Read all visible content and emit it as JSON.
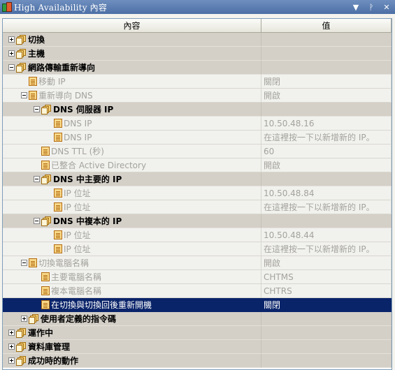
{
  "window": {
    "title": "High Availability 內容"
  },
  "columns": {
    "name": "內容",
    "value": "值"
  },
  "rows": [
    {
      "type": "cat",
      "level": 0,
      "expand": "plus",
      "icon": "folder-icon",
      "name": "切換",
      "value": ""
    },
    {
      "type": "cat",
      "level": 0,
      "expand": "plus",
      "icon": "folder-icon",
      "name": "主機",
      "value": ""
    },
    {
      "type": "cat",
      "level": 0,
      "expand": "minus",
      "icon": "folder-icon",
      "name": "網路傳輸重新導向",
      "value": ""
    },
    {
      "type": "prop",
      "level": 1,
      "expand": "none",
      "icon": "property-icon",
      "name": "移動 IP",
      "value": "關閉"
    },
    {
      "type": "prop",
      "level": 1,
      "expand": "minus",
      "icon": "property-icon",
      "name": "重新導向 DNS",
      "value": "開啟"
    },
    {
      "type": "cat",
      "level": 2,
      "expand": "minus",
      "icon": "folder-icon",
      "name": "DNS 伺服器 IP",
      "value": ""
    },
    {
      "type": "prop",
      "level": 3,
      "expand": "none",
      "icon": "property-icon",
      "name": "DNS IP",
      "value": "10.50.48.16"
    },
    {
      "type": "prop",
      "level": 3,
      "expand": "none",
      "icon": "property-icon",
      "name": "DNS IP",
      "value": "在這裡按一下以新增新的 IP。"
    },
    {
      "type": "prop",
      "level": 2,
      "expand": "none",
      "icon": "property-icon",
      "name": "DNS TTL (秒)",
      "value": "60"
    },
    {
      "type": "prop",
      "level": 2,
      "expand": "none",
      "icon": "property-icon",
      "name": "已整合 Active Directory",
      "value": "開啟"
    },
    {
      "type": "cat",
      "level": 2,
      "expand": "minus",
      "icon": "folder-icon",
      "name": "DNS 中主要的 IP",
      "value": ""
    },
    {
      "type": "prop",
      "level": 3,
      "expand": "none",
      "icon": "property-icon",
      "name": "IP 位址",
      "value": "10.50.48.84"
    },
    {
      "type": "prop",
      "level": 3,
      "expand": "none",
      "icon": "property-icon",
      "name": "IP 位址",
      "value": "在這裡按一下以新增新的 IP。"
    },
    {
      "type": "cat",
      "level": 2,
      "expand": "minus",
      "icon": "folder-icon",
      "name": "DNS 中複本的 IP",
      "value": ""
    },
    {
      "type": "prop",
      "level": 3,
      "expand": "none",
      "icon": "property-icon",
      "name": "IP 位址",
      "value": "10.50.48.44"
    },
    {
      "type": "prop",
      "level": 3,
      "expand": "none",
      "icon": "property-icon",
      "name": "IP 位址",
      "value": "在這裡按一下以新增新的 IP。"
    },
    {
      "type": "prop",
      "level": 1,
      "expand": "minus",
      "icon": "property-icon",
      "name": "切換電腦名稱",
      "value": "開啟"
    },
    {
      "type": "prop",
      "level": 2,
      "expand": "none",
      "icon": "property-icon",
      "name": "主要電腦名稱",
      "value": "CHTMS"
    },
    {
      "type": "prop",
      "level": 2,
      "expand": "none",
      "icon": "property-icon",
      "name": "複本電腦名稱",
      "value": "CHTRS"
    },
    {
      "type": "sel",
      "level": 2,
      "expand": "none",
      "icon": "property-icon",
      "name": "在切換與切換回後重新開機",
      "value": "關閉"
    },
    {
      "type": "cat",
      "level": 1,
      "expand": "plus",
      "icon": "folder-icon",
      "name": "使用者定義的指令碼",
      "value": ""
    },
    {
      "type": "cat",
      "level": 0,
      "expand": "plus",
      "icon": "folder-icon",
      "name": "運作中",
      "value": ""
    },
    {
      "type": "cat",
      "level": 0,
      "expand": "plus",
      "icon": "folder-icon",
      "name": "資料庫管理",
      "value": ""
    },
    {
      "type": "cat",
      "level": 0,
      "expand": "plus",
      "icon": "folder-icon",
      "name": "成功時的動作",
      "value": ""
    }
  ]
}
